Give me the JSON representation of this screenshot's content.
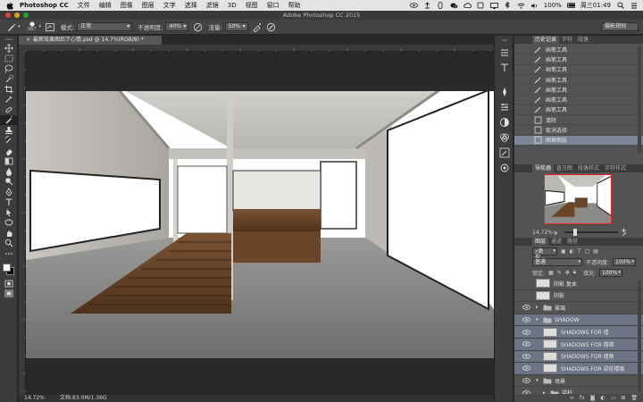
{
  "mac_menu": {
    "app_name": "Photoshop CC",
    "items": [
      "文件",
      "编辑",
      "图像",
      "图层",
      "文字",
      "选择",
      "滤镜",
      "3D",
      "视图",
      "窗口",
      "帮助"
    ],
    "battery": "100%",
    "clock": "周三01:49"
  },
  "window": {
    "title": "Adobe Photoshop CC 2015"
  },
  "options_bar": {
    "brush_size": "367",
    "mode_label": "模式:",
    "mode_value": "正常",
    "opacity_label": "不透明度:",
    "opacity_value": "40%",
    "flow_label": "流量:",
    "flow_value": "50%",
    "preset": "摄影规则"
  },
  "document": {
    "tab_title": "最新效果图后下心情.psd @ 14.7%(RGB/8) *",
    "zoom": "14.72%",
    "doc_info": "文档:83.0M/1.36G"
  },
  "history": {
    "tabs": [
      "历史记录",
      "字符",
      "段落"
    ],
    "items": [
      "画笔工具",
      "画笔工具",
      "画笔工具",
      "画笔工具",
      "画笔工具",
      "画笔工具",
      "画笔工具",
      "清除",
      "取消选择",
      "图章图层"
    ],
    "active_index": 9
  },
  "navigator": {
    "tabs": [
      "导航器",
      "直方图",
      "段落样式",
      "字符样式"
    ],
    "zoom": "14.72%"
  },
  "layers": {
    "tabs": [
      "图层",
      "通道",
      "路径"
    ],
    "filter_label": "类型",
    "blend_mode": "普通",
    "opacity_label": "不透明度:",
    "opacity": "100%",
    "lock_label": "锁定:",
    "fill_label": "填充:",
    "fill": "100%",
    "rows": [
      {
        "name": "阴影 复本",
        "kind": "thumb",
        "visible": false,
        "selected": false,
        "indent": 0
      },
      {
        "name": "阴影",
        "kind": "thumb",
        "visible": false,
        "selected": false,
        "indent": 0
      },
      {
        "name": "玻璃",
        "kind": "folder",
        "visible": true,
        "selected": false,
        "indent": 0
      },
      {
        "name": "SHADOW",
        "kind": "folder-open",
        "visible": true,
        "selected": true,
        "indent": 0
      },
      {
        "name": "SHADOWS FOR 墙",
        "kind": "thumb",
        "visible": true,
        "selected": true,
        "indent": 1
      },
      {
        "name": "SHADOWS FOR 楼梯",
        "kind": "thumb",
        "visible": true,
        "selected": true,
        "indent": 1
      },
      {
        "name": "SHADOWS FOR 墙角",
        "kind": "thumb",
        "visible": true,
        "selected": true,
        "indent": 1
      },
      {
        "name": "SHADOWS FOR 梁柱楼板",
        "kind": "thumb",
        "visible": true,
        "selected": true,
        "indent": 1
      },
      {
        "name": "场景",
        "kind": "folder-open",
        "visible": true,
        "selected": false,
        "indent": 0
      },
      {
        "name": "梁柱",
        "kind": "folder",
        "visible": true,
        "selected": false,
        "indent": 1
      }
    ]
  },
  "colors": {
    "accent_selection": "#7c8596",
    "layer_selected": "#6c7485",
    "nav_frame": "#ee2222"
  }
}
